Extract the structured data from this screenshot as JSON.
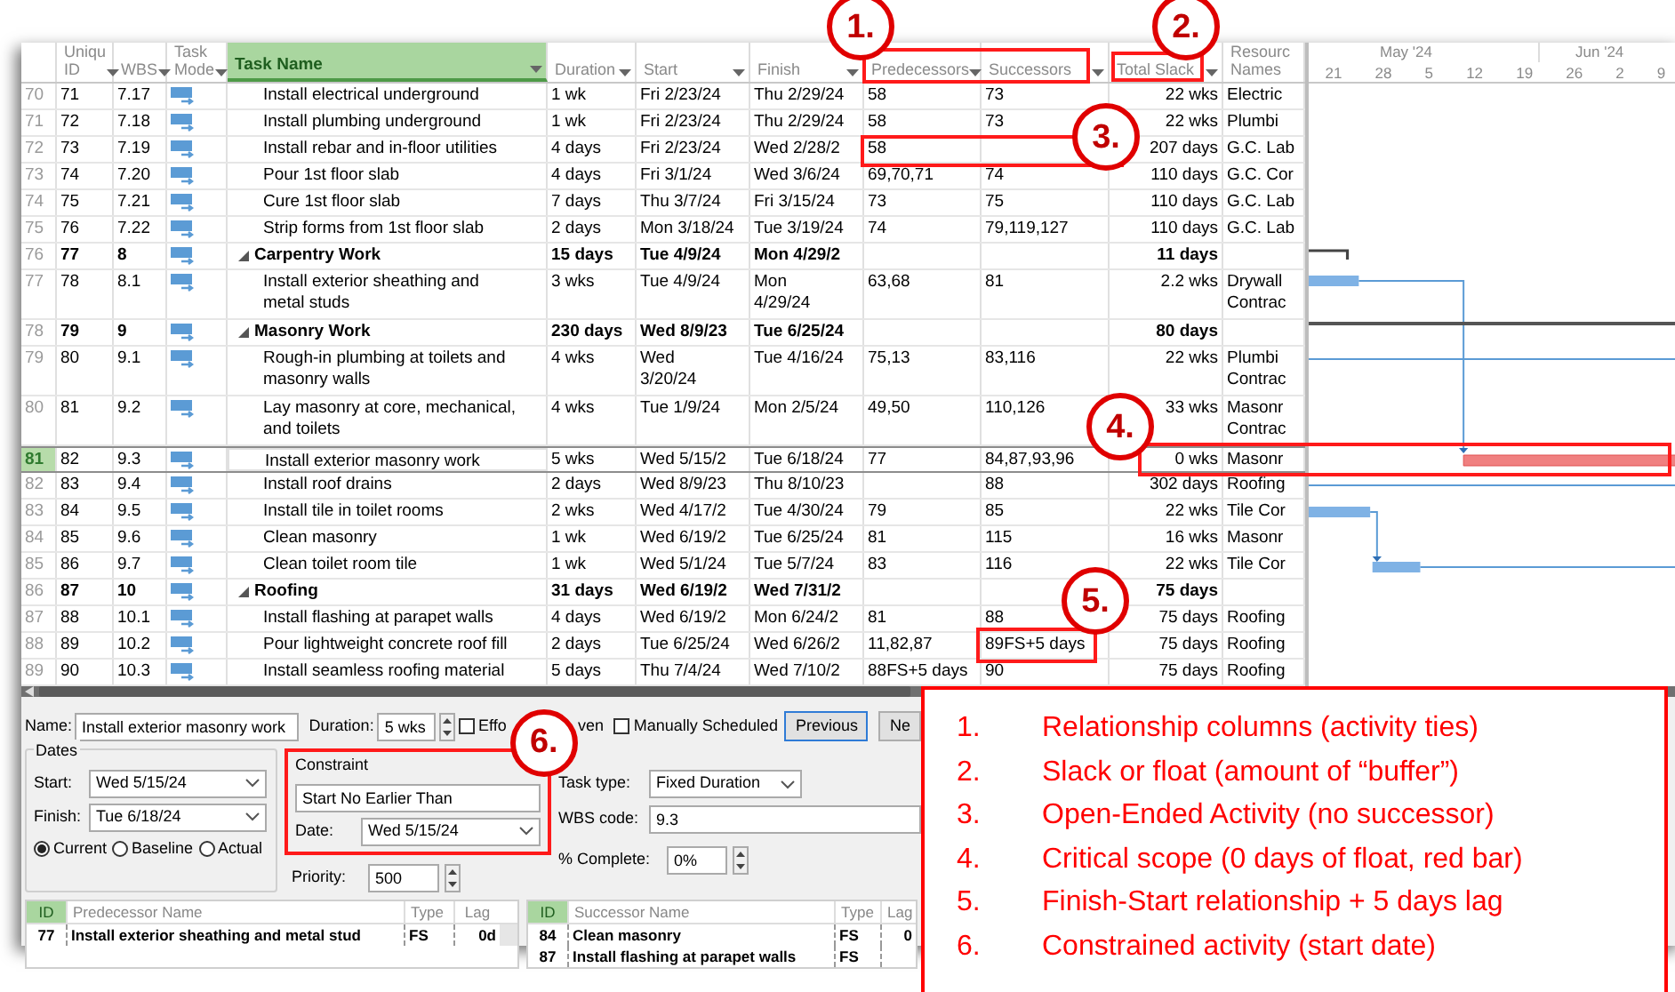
{
  "gantt_table": {
    "columns": [
      {
        "lines": [
          "Uniqu",
          "ID"
        ],
        "selected": false
      },
      {
        "lines": [
          "WBS"
        ],
        "selected": false
      },
      {
        "lines": [
          "Task",
          "Mode"
        ],
        "selected": false
      },
      {
        "lines": [
          "Task Name"
        ],
        "selected": true
      },
      {
        "lines": [
          "Duration"
        ],
        "selected": false
      },
      {
        "lines": [
          "Start"
        ],
        "selected": false
      },
      {
        "lines": [
          "Finish"
        ],
        "selected": false
      },
      {
        "lines": [
          "Predecessors"
        ],
        "selected": false
      },
      {
        "lines": [
          "Successors"
        ],
        "selected": false
      },
      {
        "lines": [
          "Total Slack"
        ],
        "selected": false
      },
      {
        "lines": [
          "Resourc",
          "Names"
        ],
        "selected": false
      }
    ],
    "rows": [
      {
        "row": "70",
        "id": "71",
        "wbs": "7.17",
        "name": "Install electrical underground",
        "duration": "1 wk",
        "start": "Fri 2/23/24",
        "finish": "Thu 2/29/24",
        "predecessors": "58",
        "successors": "73",
        "slack": "22 wks",
        "resource": "Electric",
        "summary": false,
        "selected": false
      },
      {
        "row": "71",
        "id": "72",
        "wbs": "7.18",
        "name": "Install plumbing underground",
        "duration": "1 wk",
        "start": "Fri 2/23/24",
        "finish": "Thu 2/29/24",
        "predecessors": "58",
        "successors": "73",
        "slack": "22 wks",
        "resource": "Plumbi",
        "summary": false,
        "selected": false
      },
      {
        "row": "72",
        "id": "73",
        "wbs": "7.19",
        "name": "Install rebar and in-floor utilities",
        "duration": "4 days",
        "start": "Fri 2/23/24",
        "finish": "Wed 2/28/2",
        "predecessors": "58",
        "successors": "",
        "slack": "207 days",
        "resource": "G.C. Lab",
        "summary": false,
        "selected": false
      },
      {
        "row": "73",
        "id": "74",
        "wbs": "7.20",
        "name": "Pour 1st floor slab",
        "duration": "4 days",
        "start": "Fri 3/1/24",
        "finish": "Wed 3/6/24",
        "predecessors": "69,70,71",
        "successors": "74",
        "slack": "110 days",
        "resource": "G.C. Cor",
        "summary": false,
        "selected": false
      },
      {
        "row": "74",
        "id": "75",
        "wbs": "7.21",
        "name": "Cure 1st floor slab",
        "duration": "7 days",
        "start": "Thu 3/7/24",
        "finish": "Fri 3/15/24",
        "predecessors": "73",
        "successors": "75",
        "slack": "110 days",
        "resource": "G.C. Lab",
        "summary": false,
        "selected": false
      },
      {
        "row": "75",
        "id": "76",
        "wbs": "7.22",
        "name": "Strip forms from 1st floor slab",
        "duration": "2 days",
        "start": "Mon 3/18/24",
        "finish": "Tue 3/19/24",
        "predecessors": "74",
        "successors": "79,119,127",
        "slack": "110 days",
        "resource": "G.C. Lab",
        "summary": false,
        "selected": false
      },
      {
        "row": "76",
        "id": "77",
        "wbs": "8",
        "name": "Carpentry Work",
        "duration": "15 days",
        "start": "Tue 4/9/24",
        "finish": "Mon 4/29/2",
        "predecessors": "",
        "successors": "",
        "slack": "11 days",
        "resource": "",
        "summary": true,
        "selected": false
      },
      {
        "row": "77",
        "id": "78",
        "wbs": "8.1",
        "name": [
          "Install exterior sheathing and",
          "metal studs"
        ],
        "duration": "3 wks",
        "start": "Tue 4/9/24",
        "finish": [
          "Mon",
          "4/29/24"
        ],
        "predecessors": "63,68",
        "successors": "81",
        "slack": "2.2 wks",
        "resource": [
          "Drywall",
          "Contrac"
        ],
        "summary": false,
        "selected": false
      },
      {
        "row": "78",
        "id": "79",
        "wbs": "9",
        "name": "Masonry Work",
        "duration": "230 days",
        "start": "Wed 8/9/23",
        "finish": "Tue 6/25/24",
        "predecessors": "",
        "successors": "",
        "slack": "80 days",
        "resource": "",
        "summary": true,
        "selected": false
      },
      {
        "row": "79",
        "id": "80",
        "wbs": "9.1",
        "name": [
          "Rough-in plumbing at toilets and",
          "masonry walls"
        ],
        "duration": "4 wks",
        "start": [
          "Wed",
          "3/20/24"
        ],
        "finish": "Tue 4/16/24",
        "predecessors": "75,13",
        "successors": "83,116",
        "slack": "22 wks",
        "resource": [
          "Plumbi",
          "Contrac"
        ],
        "summary": false,
        "selected": false
      },
      {
        "row": "80",
        "id": "81",
        "wbs": "9.2",
        "name": [
          "Lay masonry at core, mechanical,",
          "and toilets"
        ],
        "duration": "4 wks",
        "start": "Tue 1/9/24",
        "finish": "Mon 2/5/24",
        "predecessors": "49,50",
        "successors": "110,126",
        "slack": "33 wks",
        "resource": [
          "Masonr",
          "Contrac"
        ],
        "summary": false,
        "selected": false
      },
      {
        "row": "81",
        "id": "82",
        "wbs": "9.3",
        "name": "Install exterior masonry work",
        "duration": "5 wks",
        "start": "Wed 5/15/2",
        "finish": "Tue 6/18/24",
        "predecessors": "77",
        "successors": "84,87,93,96",
        "slack": "0 wks",
        "resource": "Masonr",
        "summary": false,
        "selected": true
      },
      {
        "row": "82",
        "id": "83",
        "wbs": "9.4",
        "name": "Install roof drains",
        "duration": "2 days",
        "start": "Wed 8/9/23",
        "finish": "Thu 8/10/23",
        "predecessors": "",
        "successors": "88",
        "slack": "302 days",
        "resource": "Roofing",
        "summary": false,
        "selected": false
      },
      {
        "row": "83",
        "id": "84",
        "wbs": "9.5",
        "name": "Install tile in toilet rooms",
        "duration": "2 wks",
        "start": "Wed 4/17/2",
        "finish": "Tue 4/30/24",
        "predecessors": "79",
        "successors": "85",
        "slack": "22 wks",
        "resource": "Tile Cor",
        "summary": false,
        "selected": false
      },
      {
        "row": "84",
        "id": "85",
        "wbs": "9.6",
        "name": "Clean masonry",
        "duration": "1 wk",
        "start": "Wed 6/19/2",
        "finish": "Tue 6/25/24",
        "predecessors": "81",
        "successors": "115",
        "slack": "16 wks",
        "resource": "Masonr",
        "summary": false,
        "selected": false
      },
      {
        "row": "85",
        "id": "86",
        "wbs": "9.7",
        "name": "Clean toilet room tile",
        "duration": "1 wk",
        "start": "Wed 5/1/24",
        "finish": "Tue 5/7/24",
        "predecessors": "83",
        "successors": "116",
        "slack": "22 wks",
        "resource": "Tile Cor",
        "summary": false,
        "selected": false
      },
      {
        "row": "86",
        "id": "87",
        "wbs": "10",
        "name": "Roofing",
        "duration": "31 days",
        "start": "Wed 6/19/2",
        "finish": "Wed 7/31/2",
        "predecessors": "",
        "successors": "",
        "slack": "75 days",
        "resource": "",
        "summary": true,
        "selected": false
      },
      {
        "row": "87",
        "id": "88",
        "wbs": "10.1",
        "name": "Install flashing at parapet walls",
        "duration": "4 days",
        "start": "Wed 6/19/2",
        "finish": "Mon 6/24/2",
        "predecessors": "81",
        "successors": "88",
        "slack": "75 days",
        "resource": "Roofing",
        "summary": false,
        "selected": false
      },
      {
        "row": "88",
        "id": "89",
        "wbs": "10.2",
        "name": "Pour lightweight concrete roof fill",
        "duration": "2 days",
        "start": "Tue 6/25/24",
        "finish": "Wed 6/26/2",
        "predecessors": "11,82,87",
        "successors": "89FS+5 days",
        "slack": "75 days",
        "resource": "Roofing",
        "summary": false,
        "selected": false
      },
      {
        "row": "89",
        "id": "90",
        "wbs": "10.3",
        "name": "Install seamless roofing material",
        "duration": "5 days",
        "start": "Thu 7/4/24",
        "finish": "Wed 7/10/2",
        "predecessors": "88FS+5 days",
        "successors": "90",
        "slack": "75 days",
        "resource": "Roofing",
        "summary": false,
        "selected": false
      }
    ]
  },
  "timescale": {
    "months": [
      "May '24",
      "Jun '24"
    ],
    "days": [
      "21",
      "28",
      "5",
      "12",
      "19",
      "26",
      "2",
      "9"
    ]
  },
  "task_form": {
    "name_label": "Name:",
    "name": "Install exterior masonry work",
    "duration_label": "Duration:",
    "duration": "5 wks",
    "effort_driven": {
      "label_start": "Effo",
      "label_end": "ven",
      "checked": false
    },
    "manually_scheduled": {
      "label": "Manually Scheduled",
      "checked": false
    },
    "buttons": [
      {
        "label": "Previous",
        "focused": true
      },
      {
        "label": "Ne",
        "focused": false
      }
    ],
    "dates": {
      "title": "Dates",
      "start_label": "Start:",
      "start": "Wed 5/15/24",
      "finish_label": "Finish:",
      "finish": "Tue 6/18/24",
      "views": [
        {
          "label": "Current",
          "selected": true
        },
        {
          "label": "Baseline",
          "selected": false
        },
        {
          "label": "Actual",
          "selected": false
        }
      ]
    },
    "constraint": {
      "title": "Constraint",
      "type": "Start No Earlier Than",
      "date_label": "Date:",
      "date": "Wed 5/15/24"
    },
    "priority_label": "Priority:",
    "priority": "500",
    "task_type_label": "Task type:",
    "task_type": "Fixed Duration",
    "wbs_label": "WBS code:",
    "wbs": "9.3",
    "complete_label": "% Complete:",
    "complete": "0%",
    "predecessors": {
      "columns": [
        "ID",
        "Predecessor Name",
        "Type",
        "Lag"
      ],
      "rows": [
        {
          "id": "77",
          "name": "Install exterior sheathing and metal stud",
          "type": "FS",
          "lag": "0d"
        }
      ]
    },
    "successors": {
      "columns": [
        "ID",
        "Successor Name",
        "Type",
        "Lag"
      ],
      "rows": [
        {
          "id": "84",
          "name": "Clean masonry",
          "type": "FS",
          "lag": "0"
        },
        {
          "id": "87",
          "name": "Install flashing at parapet walls",
          "type": "FS",
          "lag": ""
        }
      ]
    }
  },
  "callouts": [
    "1.",
    "2.",
    "3.",
    "4.",
    "5.",
    "6."
  ],
  "legend": [
    {
      "number": "1.",
      "text": "Relationship columns (activity ties)"
    },
    {
      "number": "2.",
      "text": "Slack or float (amount of “buffer”)"
    },
    {
      "number": "3.",
      "text": "Open-Ended Activity (no successor)"
    },
    {
      "number": "4.",
      "text": "Critical scope (0 days of float, red bar)"
    },
    {
      "number": "5.",
      "text": "Finish-Start relationship + 5 days lag"
    },
    {
      "number": "6.",
      "text": "Constrained activity (start date)"
    }
  ]
}
